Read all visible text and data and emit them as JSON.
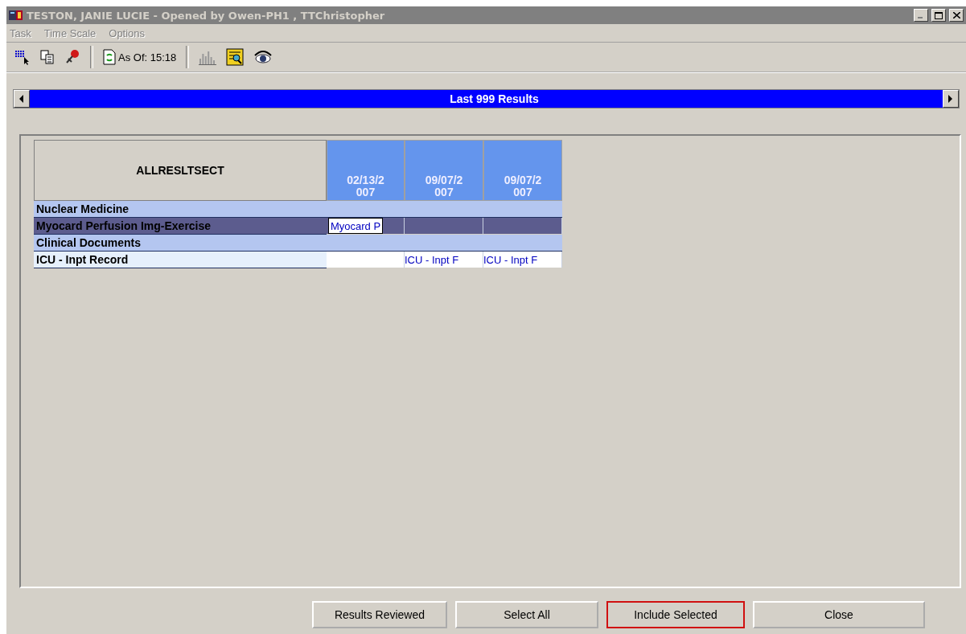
{
  "window": {
    "title": "TESTON, JANIE LUCIE - Opened by Owen-PH1 , TTChristopher"
  },
  "menu": [
    "Task",
    "Time Scale",
    "Options"
  ],
  "toolbar": {
    "as_of": "As Of: 15:18"
  },
  "range_bar": {
    "label": "Last 999 Results"
  },
  "grid": {
    "corner": "ALLRESLTSECT",
    "columns": [
      "02/13/2007",
      "09/07/2007",
      "09/07/2007"
    ],
    "rows": [
      {
        "kind": "section",
        "label": "Nuclear Medicine",
        "selected": false,
        "cells": []
      },
      {
        "kind": "item",
        "label": "Myocard Perfusion Img-Exercise",
        "selected": true,
        "cells": [
          {
            "text": "Myocard P",
            "focused": true
          },
          {
            "focused": false
          },
          {
            "focused": false
          }
        ]
      },
      {
        "kind": "section",
        "label": "Clinical Documents",
        "selected": false,
        "cells": []
      },
      {
        "kind": "item",
        "label": "ICU - Inpt Record",
        "selected": false,
        "cells": [
          {
            "focused": false
          },
          {
            "text": "ICU - Inpt F",
            "focused": false
          },
          {
            "text": "ICU - Inpt F",
            "focused": false
          }
        ]
      }
    ]
  },
  "buttons": [
    {
      "label": "Results Reviewed",
      "highlighted": false
    },
    {
      "label": "Select All",
      "highlighted": false
    },
    {
      "label": "Include Selected",
      "highlighted": true
    },
    {
      "label": "Close",
      "highlighted": false
    }
  ]
}
